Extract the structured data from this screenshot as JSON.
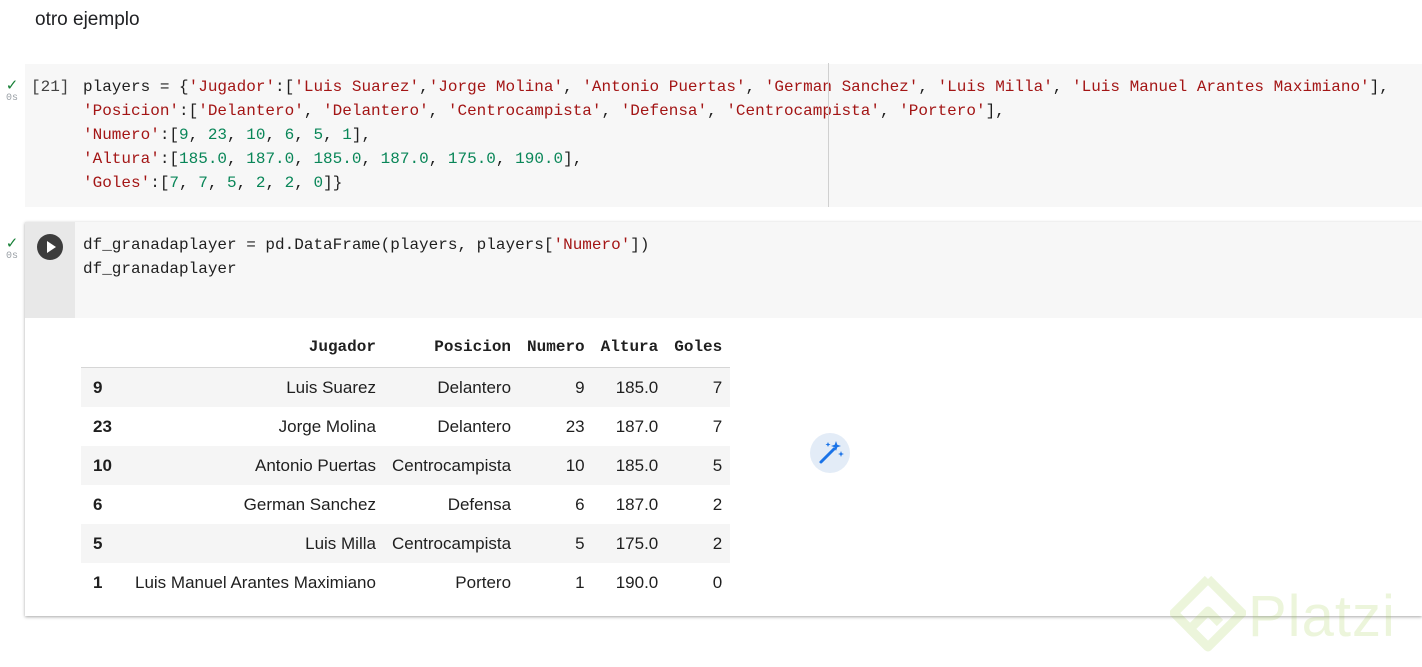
{
  "markdown": {
    "text": "otro ejemplo"
  },
  "cell1": {
    "execution_count": "[21]",
    "status_time": "0s",
    "code_lines": [
      [
        [
          "t",
          "players = {"
        ],
        [
          "s",
          "'Jugador'"
        ],
        [
          "t",
          ":["
        ],
        [
          "s",
          "'Luis Suarez'"
        ],
        [
          "t",
          ","
        ],
        [
          "s",
          "'Jorge Molina'"
        ],
        [
          "t",
          ", "
        ],
        [
          "s",
          "'Antonio Puertas'"
        ],
        [
          "t",
          ", "
        ],
        [
          "s",
          "'German Sanchez'"
        ],
        [
          "t",
          ", "
        ],
        [
          "s",
          "'Luis Milla'"
        ],
        [
          "t",
          ", "
        ],
        [
          "s",
          "'Luis Manuel Arantes Maximiano'"
        ],
        [
          "t",
          "],"
        ]
      ],
      [
        [
          "s",
          "'Posicion'"
        ],
        [
          "t",
          ":["
        ],
        [
          "s",
          "'Delantero'"
        ],
        [
          "t",
          ", "
        ],
        [
          "s",
          "'Delantero'"
        ],
        [
          "t",
          ", "
        ],
        [
          "s",
          "'Centrocampista'"
        ],
        [
          "t",
          ", "
        ],
        [
          "s",
          "'Defensa'"
        ],
        [
          "t",
          ", "
        ],
        [
          "s",
          "'Centrocampista'"
        ],
        [
          "t",
          ", "
        ],
        [
          "s",
          "'Portero'"
        ],
        [
          "t",
          "],"
        ]
      ],
      [
        [
          "s",
          "'Numero'"
        ],
        [
          "t",
          ":["
        ],
        [
          "n",
          "9"
        ],
        [
          "t",
          ", "
        ],
        [
          "n",
          "23"
        ],
        [
          "t",
          ", "
        ],
        [
          "n",
          "10"
        ],
        [
          "t",
          ", "
        ],
        [
          "n",
          "6"
        ],
        [
          "t",
          ", "
        ],
        [
          "n",
          "5"
        ],
        [
          "t",
          ", "
        ],
        [
          "n",
          "1"
        ],
        [
          "t",
          "],"
        ]
      ],
      [
        [
          "s",
          "'Altura'"
        ],
        [
          "t",
          ":["
        ],
        [
          "n",
          "185.0"
        ],
        [
          "t",
          ", "
        ],
        [
          "n",
          "187.0"
        ],
        [
          "t",
          ", "
        ],
        [
          "n",
          "185.0"
        ],
        [
          "t",
          ", "
        ],
        [
          "n",
          "187.0"
        ],
        [
          "t",
          ", "
        ],
        [
          "n",
          "175.0"
        ],
        [
          "t",
          ", "
        ],
        [
          "n",
          "190.0"
        ],
        [
          "t",
          "],"
        ]
      ],
      [
        [
          "s",
          "'Goles'"
        ],
        [
          "t",
          ":["
        ],
        [
          "n",
          "7"
        ],
        [
          "t",
          ", "
        ],
        [
          "n",
          "7"
        ],
        [
          "t",
          ", "
        ],
        [
          "n",
          "5"
        ],
        [
          "t",
          ", "
        ],
        [
          "n",
          "2"
        ],
        [
          "t",
          ", "
        ],
        [
          "n",
          "2"
        ],
        [
          "t",
          ", "
        ],
        [
          "n",
          "0"
        ],
        [
          "t",
          "]}"
        ]
      ]
    ]
  },
  "cell2": {
    "status_time": "0s",
    "code_lines": [
      [
        [
          "t",
          "df_granadaplayer = pd.DataFrame(players, players["
        ],
        [
          "s",
          "'Numero'"
        ],
        [
          "t",
          "])"
        ]
      ],
      [
        [
          "t",
          "df_granadaplayer"
        ]
      ]
    ],
    "output": {
      "columns": [
        "",
        "Jugador",
        "Posicion",
        "Numero",
        "Altura",
        "Goles"
      ],
      "rows": [
        [
          "9",
          "Luis Suarez",
          "Delantero",
          "9",
          "185.0",
          "7"
        ],
        [
          "23",
          "Jorge Molina",
          "Delantero",
          "23",
          "187.0",
          "7"
        ],
        [
          "10",
          "Antonio Puertas",
          "Centrocampista",
          "10",
          "185.0",
          "5"
        ],
        [
          "6",
          "German Sanchez",
          "Defensa",
          "6",
          "187.0",
          "2"
        ],
        [
          "5",
          "Luis Milla",
          "Centrocampista",
          "5",
          "175.0",
          "2"
        ],
        [
          "1",
          "Luis Manuel Arantes Maximiano",
          "Portero",
          "1",
          "190.0",
          "0"
        ]
      ]
    }
  },
  "icons": {
    "check": "check-icon",
    "run": "play-icon",
    "magic": "magic-wand-icon",
    "watermark": "platzi-logo"
  },
  "watermark": {
    "text": "Platzi"
  },
  "colors": {
    "string": "#a31515",
    "number": "#098658",
    "check": "#188038",
    "magic_accent": "#1a73e8"
  }
}
